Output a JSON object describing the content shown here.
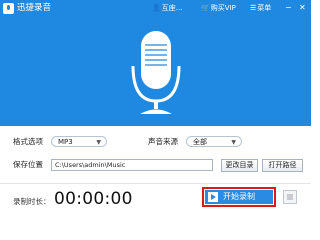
{
  "app": {
    "title": "迅捷录音"
  },
  "menu": {
    "user_label": "互座...",
    "vip_label": "购买VIP",
    "main_menu_label": "菜单"
  },
  "settings": {
    "format_label": "格式选项",
    "format_value": "MP3",
    "source_label": "声音来源",
    "source_value": "全部",
    "save_label": "保存位置",
    "save_path": "C:\\Users\\admin\\Music",
    "change_dir_label": "更改目录",
    "open_path_label": "打开路径"
  },
  "recording": {
    "duration_label": "录制时长：",
    "timer": "00:00:00",
    "start_label": "开始录制"
  },
  "colors": {
    "brand": "#1f88e0",
    "highlight": "#e01818"
  }
}
